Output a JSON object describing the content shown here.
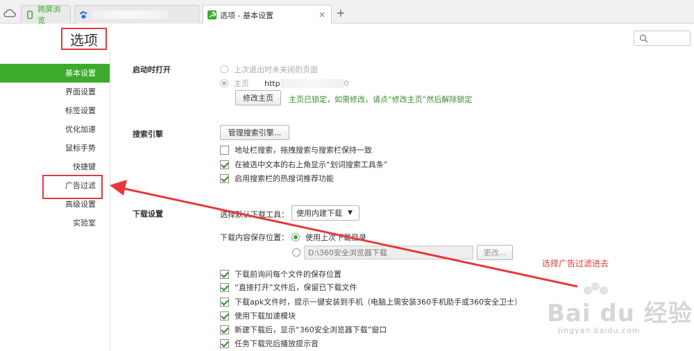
{
  "tabs": [
    {
      "label": "跨屏浏览"
    },
    {
      "label": ""
    },
    {
      "label": "选项 - 基本设置",
      "close": "×"
    }
  ],
  "new_tab_label": "+",
  "header": {
    "title": "选项",
    "search_placeholder": ""
  },
  "sidebar": {
    "items": [
      {
        "label": "基本设置"
      },
      {
        "label": "界面设置"
      },
      {
        "label": "标签设置"
      },
      {
        "label": "优化加速"
      },
      {
        "label": "鼠标手势"
      },
      {
        "label": "快捷键"
      },
      {
        "label": "广告过滤"
      },
      {
        "label": "高级设置"
      },
      {
        "label": "实验室"
      }
    ]
  },
  "startup": {
    "label": "启动时打开",
    "opt_last_session": "上次退出时未关闭的页面",
    "opt_homepage": "主页",
    "homepage_url_prefix": "http",
    "homepage_url_suffix": "0",
    "modify_button": "修改主页",
    "locked_note": "主页已锁定，如需修改，请点“修改主页”然后解除锁定"
  },
  "search": {
    "label": "搜索引擎",
    "manage_button": "管理搜索引擎...",
    "opt_sync": "地址栏搜索，拖拽搜索与搜索栏保持一致",
    "opt_toolbar": "在被选中文本的右上角显示“划词搜索工具条”",
    "opt_hotwords": "启用搜索栏的热搜词推荐功能"
  },
  "download": {
    "label": "下载设置",
    "tool_label": "选择默认下载工具：",
    "tool_value": "使用内建下载",
    "save_label": "下载内容保存位置：",
    "opt_last_dir": "使用上次下载目录",
    "path_value": "D:\\360安全浏览器下载",
    "change_button": "更改...",
    "opt_ask": "下载前询问每个文件的保存位置",
    "opt_direct_open": "“直接打开”文件后，保留已下载文件",
    "opt_apk": "下载apk文件时，提示一键安装到手机（电脑上需安装360手机助手或360安全卫士）",
    "opt_accel": "使用下载加速模块",
    "opt_show_window": "新建下载后，显示“360安全浏览器下载”窗口",
    "opt_sound": "任务下载完后播放提示音"
  },
  "annotation": "选择广告过滤进去",
  "watermark": {
    "text": "Bai du 经验",
    "url": "jingyan.baidu.com"
  },
  "checks": {
    "search_sync": false,
    "search_toolbar": true,
    "search_hotwords": true,
    "ask": true,
    "direct_open": true,
    "apk": true,
    "accel": true,
    "show_window": true,
    "sound": true
  },
  "colors": {
    "accent": "#3cab2c",
    "highlight": "#e5393c"
  }
}
